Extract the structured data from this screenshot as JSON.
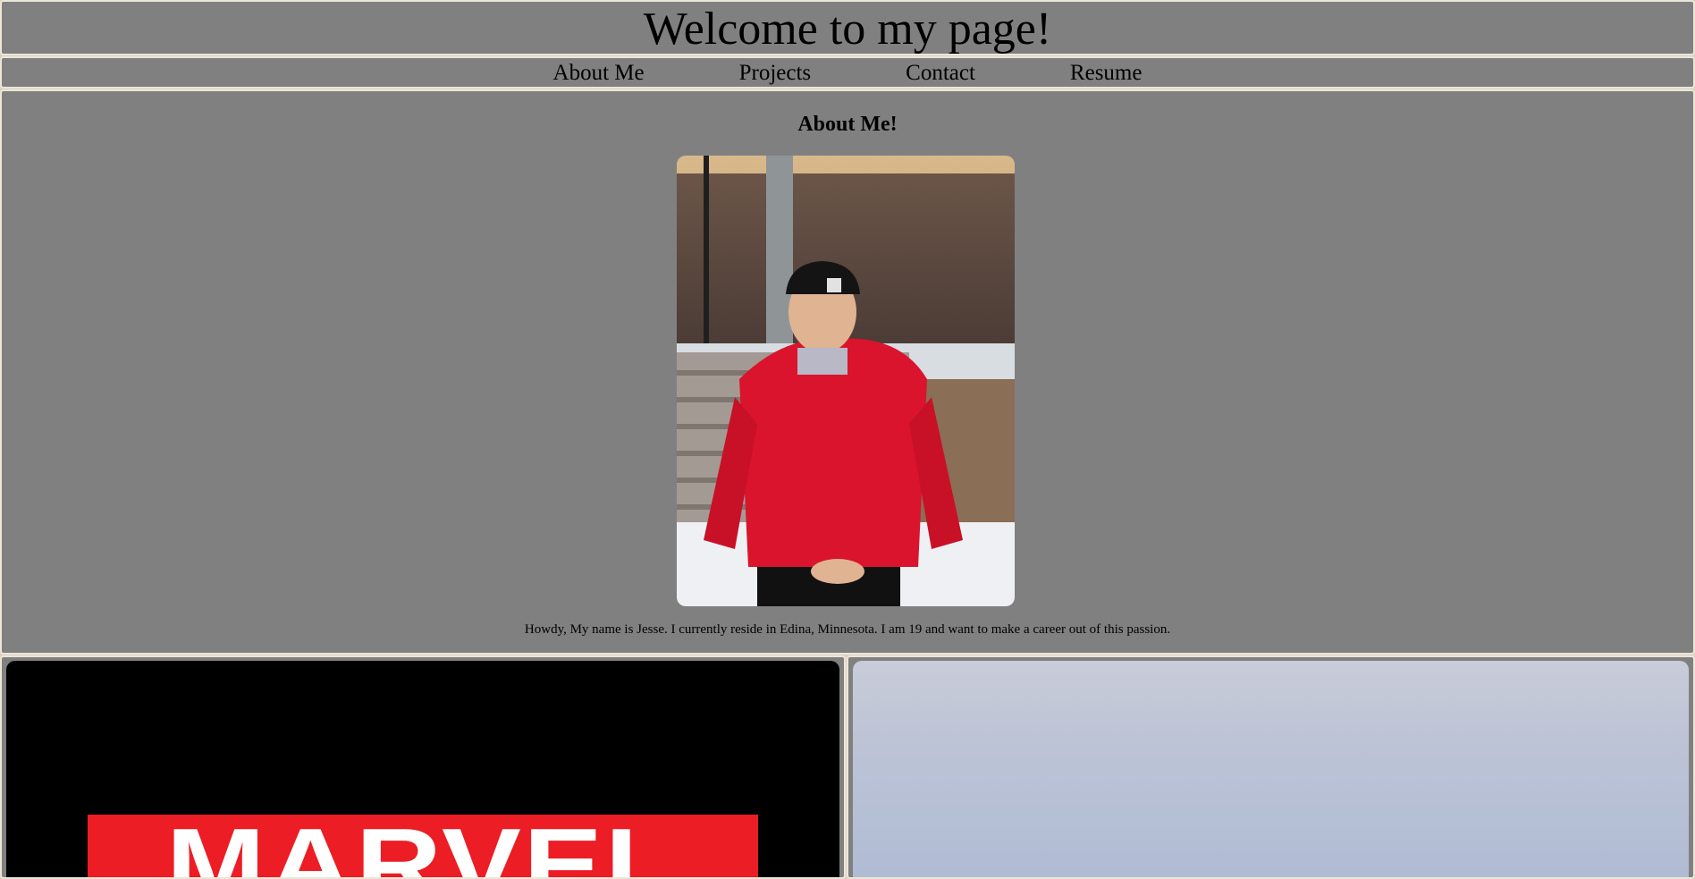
{
  "header": {
    "title": "Welcome to my page!"
  },
  "nav": {
    "items": [
      {
        "label": "About Me"
      },
      {
        "label": "Projects"
      },
      {
        "label": "Contact"
      },
      {
        "label": "Resume"
      }
    ]
  },
  "about": {
    "heading": "About Me!",
    "bio": "Howdy, My name is Jesse. I currently reside in Edina, Minnesota. I am 19 and want to make a career out of this passion."
  },
  "cards": {
    "left": {
      "logo_text": "MARVEL",
      "colors": {
        "background": "#000000",
        "logo": "#ec1d24"
      }
    },
    "right": {
      "colors": {
        "sky_top": "#c9ccd8",
        "sky_bottom": "#b0bcd4"
      }
    }
  },
  "colors": {
    "panel": "#808080",
    "border": "#ece6d8",
    "page": "#d9d2c4"
  }
}
